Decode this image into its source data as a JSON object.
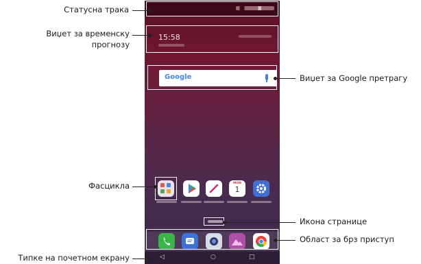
{
  "callouts": {
    "status_bar": "Статусна трака",
    "weather_widget_line1": "Виџет за временску",
    "weather_widget_line2": "прогнозу",
    "google_widget": "Виџет за Google претрагу",
    "folder": "Фасцикла",
    "page_icon": "Икона странице",
    "quick_access": "Област за брз приступ",
    "home_touch_buttons": "Типке на почетном екрану"
  },
  "screen": {
    "time": "15:58",
    "search_brand": "Google",
    "calendar_month": "MON",
    "calendar_day": "1",
    "nav": {
      "back": "◁",
      "home": "○",
      "recents": "□"
    }
  },
  "colors": {
    "google_blue": "#4285f4",
    "google_red": "#ea4335",
    "google_yellow": "#fbbc05",
    "google_green": "#34a853"
  }
}
